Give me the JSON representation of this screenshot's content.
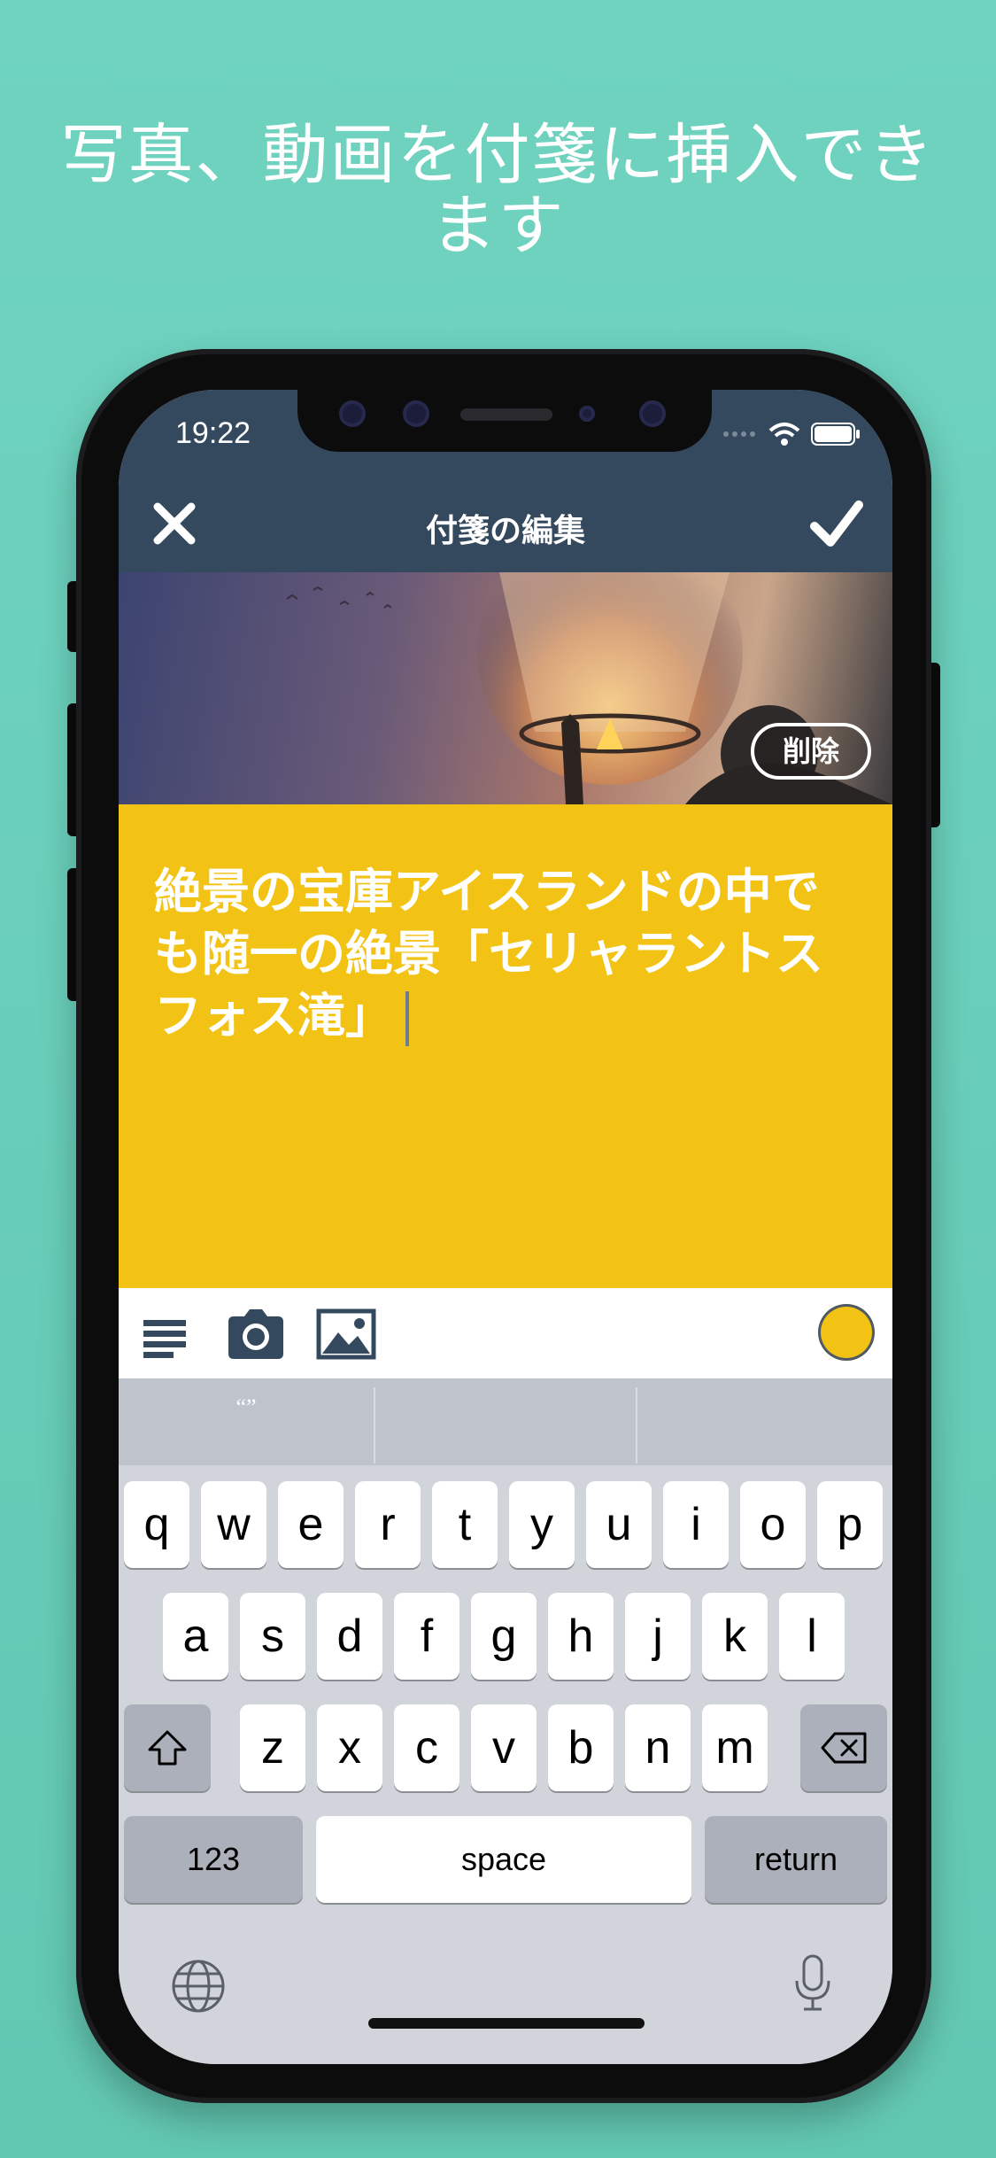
{
  "headline": "写真、動画を付箋に挿入できます",
  "status": {
    "time": "19:22"
  },
  "nav": {
    "title": "付箋の編集",
    "close_icon": "close-icon",
    "done_icon": "checkmark-icon"
  },
  "photo": {
    "delete_label": "削除"
  },
  "note": {
    "text": "絶景の宝庫アイスランドの中でも随一の絶景「セリャラントスフォス滝」",
    "color": "#f2c315"
  },
  "toolbar": {
    "items": [
      "format-icon",
      "camera-icon",
      "image-icon",
      "color-picker"
    ]
  },
  "predictive": {
    "left": "“”",
    "middle": "",
    "right": ""
  },
  "keyboard": {
    "row1": [
      "q",
      "w",
      "e",
      "r",
      "t",
      "y",
      "u",
      "i",
      "o",
      "p"
    ],
    "row2": [
      "a",
      "s",
      "d",
      "f",
      "g",
      "h",
      "j",
      "k",
      "l"
    ],
    "row3": [
      "z",
      "x",
      "c",
      "v",
      "b",
      "n",
      "m"
    ],
    "numbers_label": "123",
    "space_label": "space",
    "return_label": "return"
  },
  "colors": {
    "background": "#6fd3c0",
    "navbar": "#34495e",
    "note": "#f2c315"
  }
}
